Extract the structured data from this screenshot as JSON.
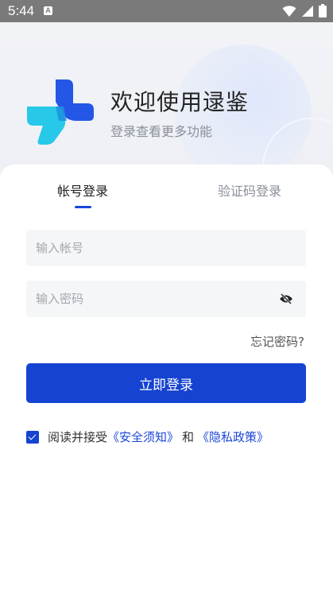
{
  "status_bar": {
    "time": "5:44",
    "notification_letter": "A"
  },
  "header": {
    "title": "欢迎使用逯鉴",
    "subtitle": "登录查看更多功能"
  },
  "tabs": [
    {
      "label": "帐号登录",
      "active": true
    },
    {
      "label": "验证码登录",
      "active": false
    }
  ],
  "form": {
    "account_placeholder": "输入帐号",
    "account_value": "",
    "password_placeholder": "输入密码",
    "password_value": "",
    "forgot_label": "忘记密码?",
    "submit_label": "立即登录"
  },
  "agreement": {
    "checked": true,
    "prefix": "阅读并接受",
    "link1": "《安全须知》",
    "conjunction": "和",
    "link2": "《隐私政策》"
  },
  "colors": {
    "primary": "#1543d2",
    "logo_blue": "#2457e6",
    "logo_cyan": "#27c8e8"
  },
  "icons": {
    "eye_toggle": "eye-off-icon"
  }
}
